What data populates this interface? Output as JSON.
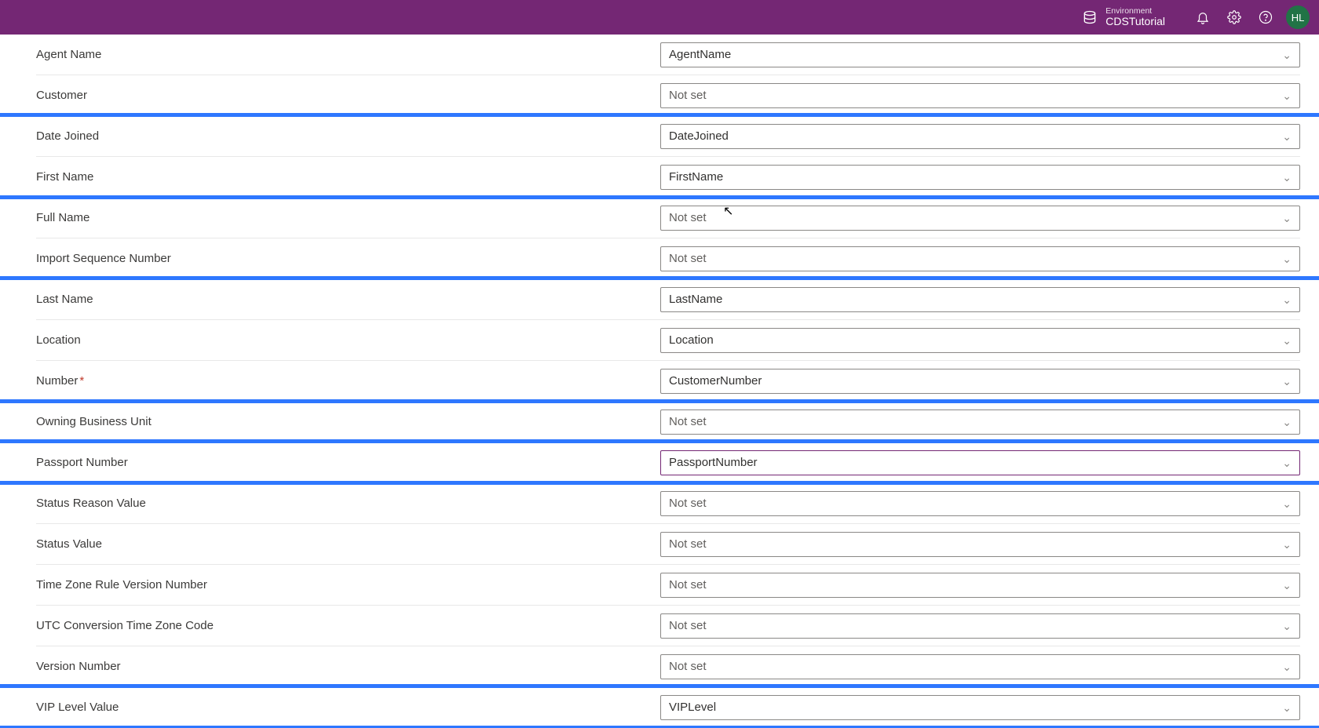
{
  "header": {
    "env_label": "Environment",
    "env_name": "CDSTutorial",
    "avatar_initials": "HL"
  },
  "rows": [
    {
      "id": "agent-name",
      "label": "Agent Name",
      "value": "AgentName",
      "set": true
    },
    {
      "id": "customer",
      "label": "Customer",
      "value": "Not set",
      "set": false
    },
    {
      "id": "date-joined",
      "label": "Date Joined",
      "value": "DateJoined",
      "set": true
    },
    {
      "id": "first-name",
      "label": "First Name",
      "value": "FirstName",
      "set": true
    },
    {
      "id": "full-name",
      "label": "Full Name",
      "value": "Not set",
      "set": false
    },
    {
      "id": "import-seq",
      "label": "Import Sequence Number",
      "value": "Not set",
      "set": false
    },
    {
      "id": "last-name",
      "label": "Last Name",
      "value": "LastName",
      "set": true
    },
    {
      "id": "location",
      "label": "Location",
      "value": "Location",
      "set": true
    },
    {
      "id": "number",
      "label": "Number",
      "required": true,
      "value": "CustomerNumber",
      "set": true
    },
    {
      "id": "owning-bu",
      "label": "Owning Business Unit",
      "value": "Not set",
      "set": false
    },
    {
      "id": "passport-number",
      "label": "Passport Number",
      "value": "PassportNumber",
      "set": true,
      "focused": true
    },
    {
      "id": "status-reason",
      "label": "Status Reason Value",
      "value": "Not set",
      "set": false
    },
    {
      "id": "status-value",
      "label": "Status Value",
      "value": "Not set",
      "set": false
    },
    {
      "id": "tz-rule-version",
      "label": "Time Zone Rule Version Number",
      "value": "Not set",
      "set": false
    },
    {
      "id": "utc-offset",
      "label": "UTC Conversion Time Zone Code",
      "value": "Not set",
      "set": false
    },
    {
      "id": "version-number",
      "label": "Version Number",
      "value": "Not set",
      "set": false
    },
    {
      "id": "vip-level",
      "label": "VIP Level Value",
      "value": "VIPLevel",
      "set": true
    }
  ],
  "highlights": [
    {
      "from": "date-joined",
      "to": "first-name"
    },
    {
      "from": "last-name",
      "to": "number"
    },
    {
      "from": "passport-number",
      "to": "passport-number"
    },
    {
      "from": "vip-level",
      "to": "vip-level"
    }
  ]
}
